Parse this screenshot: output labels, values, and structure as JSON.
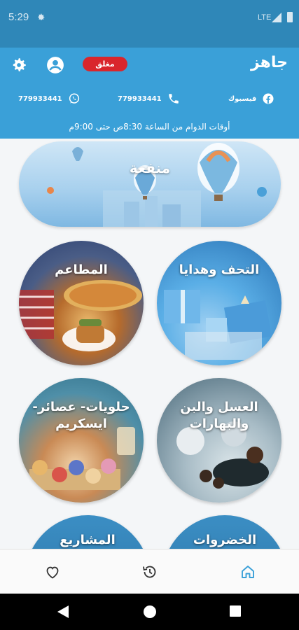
{
  "status_bar": {
    "time": "5:29",
    "network": "LTE"
  },
  "header": {
    "title": "جاهز",
    "closed_badge": "مغلق",
    "contacts": {
      "facebook_label": "فيسبوك",
      "phone_number": "779933441",
      "whatsapp_number": "779933441"
    },
    "working_hours": "أوقات الدوام من الساعة 8:30ص  حتى  9:00م"
  },
  "banner": {
    "label": "منفعة"
  },
  "categories": [
    {
      "label": "التحف وهدايا"
    },
    {
      "label": "المطاعم"
    },
    {
      "label": "العسل والبن والبهارات"
    },
    {
      "label": "حلويات- عصائر- ايسكريم"
    },
    {
      "label": "الخضروات"
    },
    {
      "label": "المشاريع"
    }
  ],
  "colors": {
    "header": "#3aa0d8",
    "status_bar": "#2f87b8",
    "closed_badge": "#d9262c",
    "active_nav": "#3aa0d8"
  },
  "bottom_nav": {
    "icons": [
      "heart-icon",
      "history-icon",
      "home-icon"
    ],
    "active": "home-icon"
  }
}
